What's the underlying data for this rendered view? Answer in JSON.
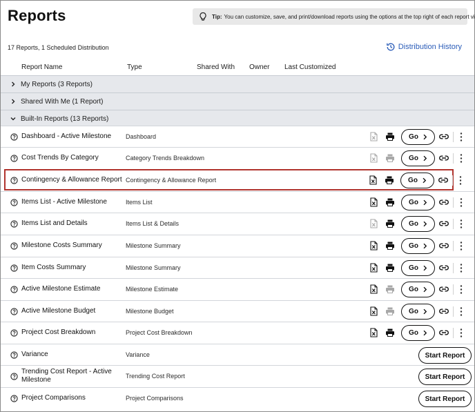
{
  "page": {
    "title": "Reports"
  },
  "tip": {
    "label": "Tip:",
    "text": "You can customize, save, and print/download reports using the options at the top right of each report view"
  },
  "summary": "17 Reports, 1 Scheduled Distribution",
  "distribution_history": "Distribution History",
  "columns": {
    "name": "Report Name",
    "type": "Type",
    "shared": "Shared With",
    "owner": "Owner",
    "last": "Last Customized"
  },
  "groups": [
    {
      "label": "My Reports (3 Reports)",
      "expanded": false
    },
    {
      "label": "Shared With Me (1 Report)",
      "expanded": false
    },
    {
      "label": "Built-In Reports (13 Reports)",
      "expanded": true
    }
  ],
  "go_label": "Go",
  "start_label": "Start Report",
  "reports": [
    {
      "name": "Dashboard - Active Milestone",
      "type": "Dashboard",
      "excel_enabled": false,
      "print_enabled": true
    },
    {
      "name": "Cost Trends By Category",
      "type": "Category Trends Breakdown",
      "excel_enabled": false,
      "print_enabled": false
    },
    {
      "name": "Contingency & Allowance Report",
      "type": "Contingency & Allowance Report",
      "excel_enabled": true,
      "print_enabled": true,
      "highlighted": true
    },
    {
      "name": "Items List - Active Milestone",
      "type": "Items List",
      "excel_enabled": true,
      "print_enabled": true
    },
    {
      "name": "Items List and Details",
      "type": "Items List & Details",
      "excel_enabled": false,
      "print_enabled": true
    },
    {
      "name": "Milestone Costs Summary",
      "type": "Milestone Summary",
      "excel_enabled": true,
      "print_enabled": true
    },
    {
      "name": "Item Costs Summary",
      "type": "Milestone Summary",
      "excel_enabled": true,
      "print_enabled": true
    },
    {
      "name": "Active Milestone Estimate",
      "type": "Milestone Estimate",
      "excel_enabled": true,
      "print_enabled": false
    },
    {
      "name": "Active Milestone Budget",
      "type": "Milestone Budget",
      "excel_enabled": true,
      "print_enabled": false
    },
    {
      "name": "Project Cost Breakdown",
      "type": "Project Cost Breakdown",
      "excel_enabled": true,
      "print_enabled": true
    },
    {
      "name": "Variance",
      "type": "Variance"
    },
    {
      "name": "Trending Cost Report - Active Milestone",
      "type": "Trending Cost Report"
    },
    {
      "name": "Project Comparisons",
      "type": "Project Comparisons"
    }
  ],
  "icons": {
    "tip": "lightbulb-icon",
    "history": "history-icon",
    "help": "help-circle-icon",
    "excel": "excel-file-icon",
    "print": "printer-icon",
    "link": "link-icon",
    "more": "more-vertical-icon"
  },
  "colors": {
    "link": "#2a5cb8",
    "group_bg": "#e6e8ec",
    "highlight_border": "#b0332d",
    "tip_bg": "#e8e8e8"
  }
}
